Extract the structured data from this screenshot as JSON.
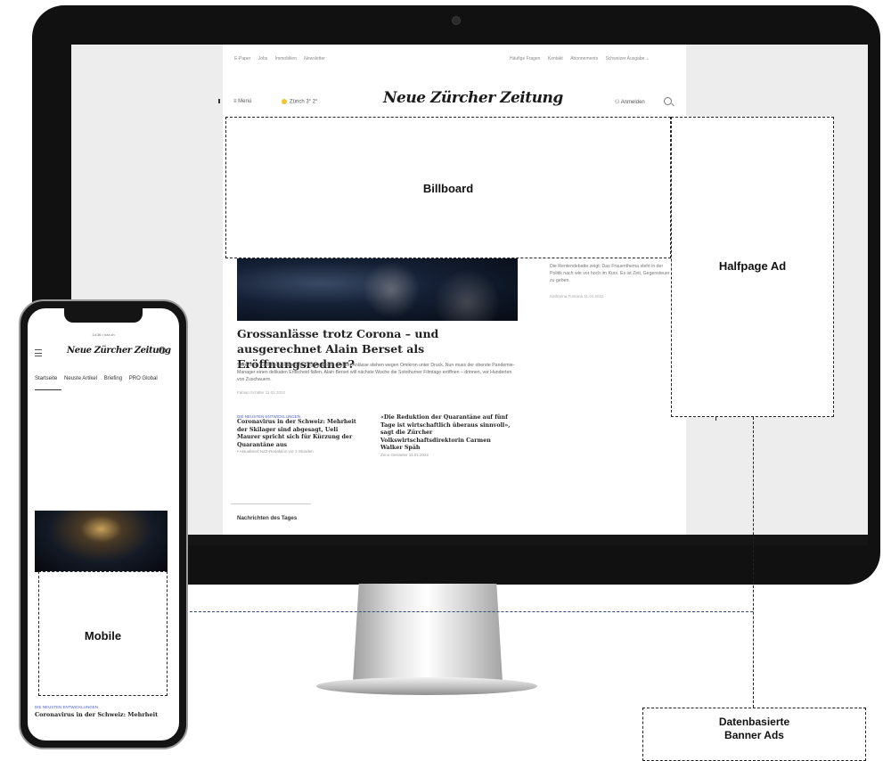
{
  "site": {
    "top_nav_left": [
      "E-Paper",
      "Jobs",
      "Immobilien",
      "Newsletter"
    ],
    "top_nav_right": [
      "Häufige Fragen",
      "Kontakt",
      "Abonnements",
      "Schweizer Ausgabe ⌄"
    ],
    "menu_label": "≡  Menü",
    "weather": "Zürich 3° 2°",
    "masthead": "Neue Zürcher Zeitung",
    "login_label": "Anmelden"
  },
  "article": {
    "headline": "Grossanlässe trotz Corona – und ausgerechnet Alain Berset als Eröffnungsredner?",
    "teaser": "Skirennen, Eishockey, Fasnacht: Organisatoren grosser Anlässe stehen wegen Omikron unter Druck. Nun muss der oberste Pandemie-Manager einen delikaten Entscheid fällen. Alain Berset will nächste Woche die Solothurner Filmtage eröffnen – drinnen, vor Hunderten von Zuschauern.",
    "byline": "Fabian Schäfer  11.01.2022"
  },
  "sidebar": {
    "text": "Die Rentendebatte zeigt: Das Frauenthema steht in der Politik nach wie vor hoch im Kurs. Es ist Zeit, Gegensteuer zu geben.",
    "byline": "Katharina Fontana  11.01.2022"
  },
  "columns": [
    {
      "kicker": "DIE NEUSTEN ENTWICKLUNGEN",
      "title": "Coronavirus in der Schweiz: Mehrheit der Skilager sind abgesagt, Ueli Maurer spricht sich für Kürzung der Quarantäne aus",
      "meta": "• Aktualisiert  NZZ-Redaktion  vor 2 Stunden"
    },
    {
      "kicker": "",
      "title": "«Die Reduktion der Quarantäne auf fünf Tage ist wirtschaftlich überaus sinnvoll», sagt die Zürcher Volkswirtschaftsdirektorin Carmen Walker Späh",
      "meta": "Zeno Geisseler  11.01.2022"
    }
  ],
  "news_section_title": "Nachrichten des Tages",
  "ad_labels": {
    "billboard": "Billboard",
    "halfpage": "Halfpage Ad",
    "mobile": "Mobile",
    "daten_line1": "Datenbasierte",
    "daten_line2": "Banner Ads"
  },
  "phone": {
    "status": "14:36 • nzz.ch",
    "masthead": "Neue Zürcher Zeitung",
    "tabs": [
      "Startseite",
      "Neuste Artikel",
      "Briefing",
      "PRO Global"
    ],
    "kicker": "DIE NEUSTEN ENTWICKLUNGEN",
    "headline": "Coronavirus in der Schweiz: Mehrheit"
  },
  "colors": {
    "monitor_bezel": "#111111",
    "screen_bg": "#ededed",
    "kicker_blue": "#4a60d9",
    "connector_blue": "#2f4a75"
  },
  "icons": [
    "camera-icon",
    "menu-icon",
    "sun-icon",
    "person-icon",
    "search-icon",
    "bookmark-icon"
  ]
}
